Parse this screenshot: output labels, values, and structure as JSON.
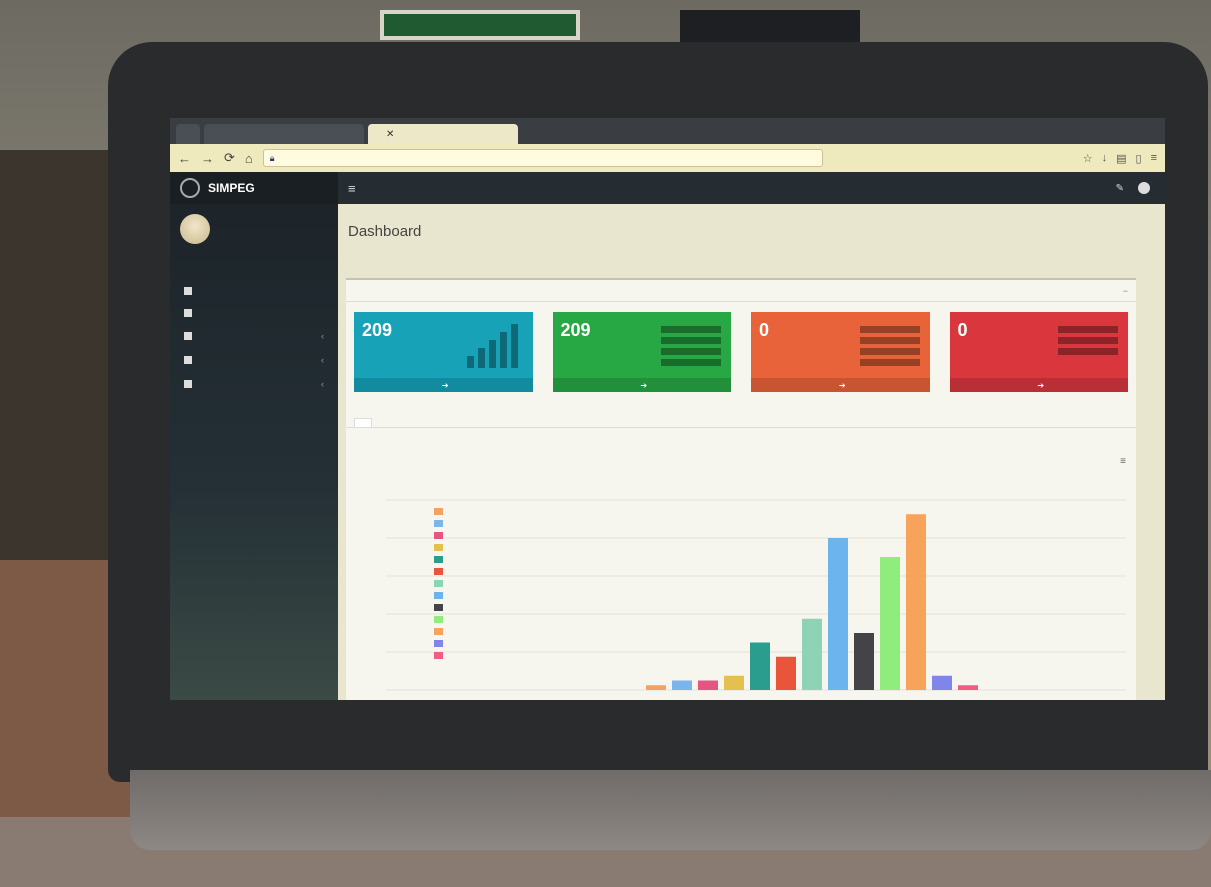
{
  "browser": {
    "tabs": [
      {
        "label": "",
        "active": false
      },
      {
        "label": "",
        "active": false
      },
      {
        "label": "",
        "active": true
      }
    ],
    "url": ""
  },
  "app": {
    "brand": "SIMPEG",
    "brand_sub": "",
    "user": {
      "name": "",
      "role": ""
    },
    "menu": [
      {
        "label": "",
        "icon": "dashboard-icon",
        "has_children": false
      },
      {
        "label": "",
        "icon": "user-icon",
        "has_children": false
      },
      {
        "label": "",
        "icon": "users-icon",
        "has_children": true
      },
      {
        "label": "",
        "icon": "list-icon",
        "has_children": true
      },
      {
        "label": "",
        "icon": "file-icon",
        "has_children": true
      }
    ]
  },
  "topbar": {
    "user_label": ""
  },
  "page": {
    "title": "Dashboard",
    "breadcrumb": ""
  },
  "box": {
    "title": ""
  },
  "cards": [
    {
      "value": "209",
      "label": "",
      "footer": "",
      "color": "#17a2b8"
    },
    {
      "value": "209",
      "label": "",
      "footer": "",
      "color": "#28a745"
    },
    {
      "value": "0",
      "label": "",
      "footer": "",
      "color": "#e8633a"
    },
    {
      "value": "0",
      "label": "",
      "footer": "",
      "color": "#d9363e"
    }
  ],
  "chart_tabs": [
    {
      "label": "",
      "active": true
    },
    {
      "label": "",
      "active": false
    }
  ],
  "chart": {
    "title": "",
    "subtitle": ""
  },
  "chart_data": {
    "type": "bar",
    "categories": [
      "",
      "",
      "",
      "",
      "",
      "",
      "",
      "",
      "",
      "",
      "",
      "",
      "",
      "",
      "",
      "",
      ""
    ],
    "values": [
      1,
      2,
      2,
      3,
      10,
      7,
      15,
      32,
      12,
      28,
      37,
      3,
      1,
      0,
      0,
      0,
      0
    ],
    "colors": [
      "#f4a261",
      "#7cb5ec",
      "#e75480",
      "#e4c04f",
      "#2a9d8f",
      "#e9553b",
      "#8fd3b6",
      "#6cb4ee",
      "#434348",
      "#90ed7d",
      "#f7a35c",
      "#8085e9",
      "#f15c80",
      "#e4d354",
      "#2b908f",
      "#f45b5b",
      "#91e8e1"
    ],
    "ylim": [
      0,
      40
    ],
    "legend": "left",
    "grid": true
  }
}
